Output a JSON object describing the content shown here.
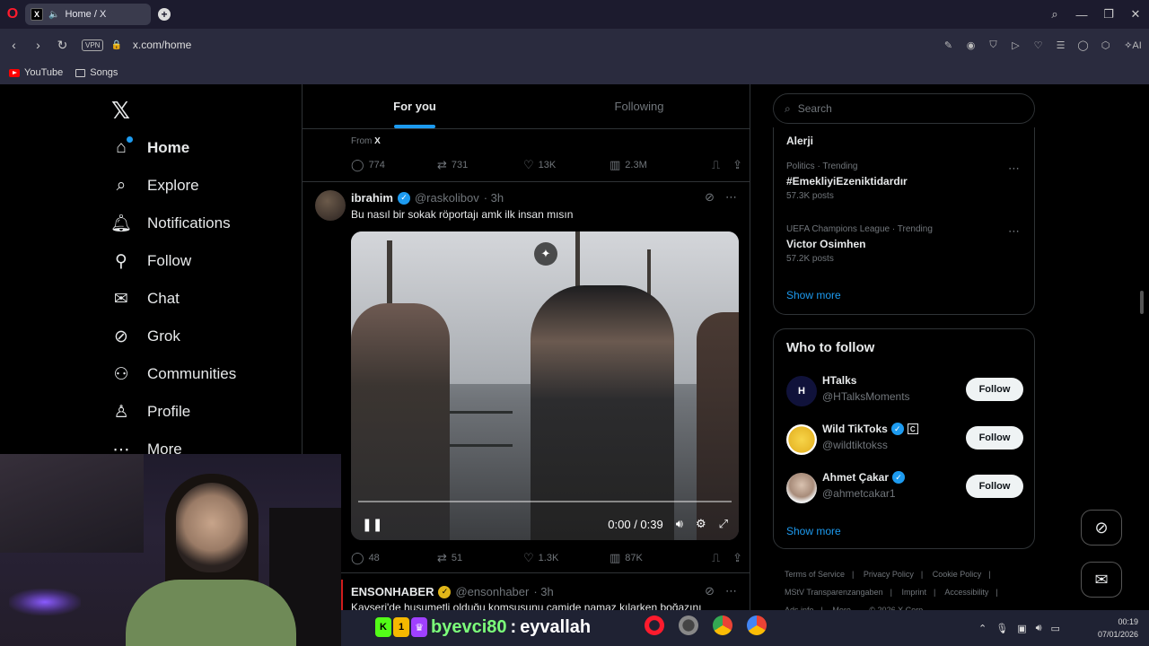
{
  "browser": {
    "tab_title": "Home / X",
    "url": "x.com/home",
    "vpn_label": "VPN",
    "ai_label": "AI",
    "bookmarks": [
      "YouTube",
      "Songs"
    ]
  },
  "nav": {
    "items": [
      {
        "label": "Home",
        "icon": "home-icon"
      },
      {
        "label": "Explore",
        "icon": "search-icon"
      },
      {
        "label": "Notifications",
        "icon": "bell-icon"
      },
      {
        "label": "Follow",
        "icon": "person-add-icon"
      },
      {
        "label": "Chat",
        "icon": "envelope-icon"
      },
      {
        "label": "Grok",
        "icon": "grok-icon"
      },
      {
        "label": "Communities",
        "icon": "people-icon"
      },
      {
        "label": "Profile",
        "icon": "person-icon"
      },
      {
        "label": "More",
        "icon": "more-circle-icon"
      }
    ]
  },
  "feed": {
    "tabs": [
      "For you",
      "Following"
    ],
    "prev_tweet": {
      "from_prefix": "From",
      "from_name": "X",
      "replies": "774",
      "reposts": "731",
      "likes": "13K",
      "views": "2.3M"
    },
    "tweet": {
      "name": "ibrahim",
      "handle": "@raskolibov",
      "time": "· 3h",
      "text": "Bu nasıl bir sokak röportajı amk ilk insan mısın",
      "video_time": "0:00 / 0:39",
      "video_progress": 0.0,
      "replies": "48",
      "reposts": "51",
      "likes": "1.3K",
      "views": "87K"
    },
    "next_tweet": {
      "name": "ENSONHABER",
      "handle": "@ensonhaber",
      "time": "· 3h",
      "text": "Kayseri'de husumetli olduğu komşusunu camide namaz kılarken boğazını"
    }
  },
  "sidebar": {
    "search_placeholder": "Search",
    "top_trend_title": "Alerji",
    "trends": [
      {
        "meta": "Politics · Trending",
        "title": "#EmekliyiEzeniktidardır",
        "posts": "57.3K posts"
      },
      {
        "meta": "UEFA Champions League · Trending",
        "title": "Victor Osimhen",
        "posts": "57.2K posts"
      }
    ],
    "trends_show_more": "Show more",
    "who_to_follow": {
      "title": "Who to follow",
      "users": [
        {
          "name": "HTalks",
          "handle": "@HTalksMoments",
          "button": "Follow"
        },
        {
          "name": "Wild TikToks",
          "handle": "@wildtiktokss",
          "badge": "C",
          "button": "Follow"
        },
        {
          "name": "Ahmet Çakar",
          "handle": "@ahmetcakar1",
          "button": "Follow"
        }
      ],
      "show_more": "Show more"
    },
    "footer": {
      "line1": [
        "Terms of Service",
        "|",
        "Privacy Policy",
        "|",
        "Cookie Policy",
        "|"
      ],
      "line2": [
        "MStV Transparenzangaben",
        "|",
        "Imprint",
        "|",
        "Accessibility",
        "|"
      ],
      "line3": [
        "Ads info",
        "|",
        "More ...",
        "© 2026 X Corp."
      ]
    }
  },
  "overlay": {
    "chat_user": "byevci80",
    "chat_separator": ":",
    "chat_message": "eyvallah",
    "badges": [
      "K",
      "1",
      "♛"
    ]
  },
  "taskbar": {
    "time": "00:19",
    "date": "07/01/2026"
  },
  "colors": {
    "accent": "#1d9bf0",
    "background": "#000000",
    "border": "#2f3336",
    "muted": "#71767b"
  }
}
